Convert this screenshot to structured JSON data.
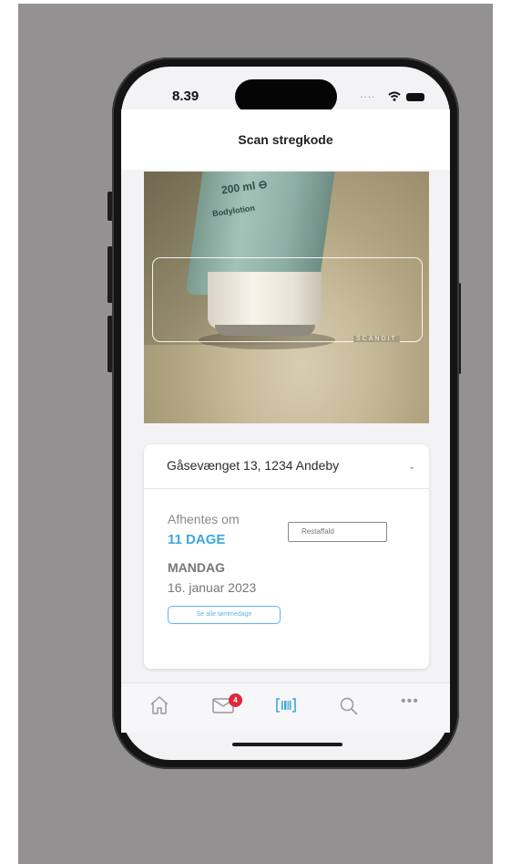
{
  "status_bar": {
    "time": "8.39",
    "signal": "...."
  },
  "header": {
    "title": "Scan stregkode"
  },
  "scanner": {
    "brand_label": "SCANDIT",
    "product_text_1": "200 ml ⊖",
    "product_text_2": "Bodylotion"
  },
  "card": {
    "address": "Gåsevænget 13, 1234 Andeby",
    "pickup_label": "Afhentes om",
    "days_until": "11 DAGE",
    "waste_type": "Restaffald",
    "weekday": "MANDAG",
    "date": "16. januar 2023",
    "all_dates_button": "Se alle tømmedage"
  },
  "tab_bar": {
    "items": [
      {
        "name": "home",
        "icon": "home-icon"
      },
      {
        "name": "messages",
        "icon": "mail-icon",
        "badge": "4"
      },
      {
        "name": "scan",
        "icon": "barcode-scan-icon"
      },
      {
        "name": "search",
        "icon": "search-icon"
      },
      {
        "name": "more",
        "icon": "more-icon",
        "label": "•••"
      }
    ]
  },
  "colors": {
    "accent": "#3ba7e0",
    "badge": "#e0283a",
    "background": "#939191"
  }
}
